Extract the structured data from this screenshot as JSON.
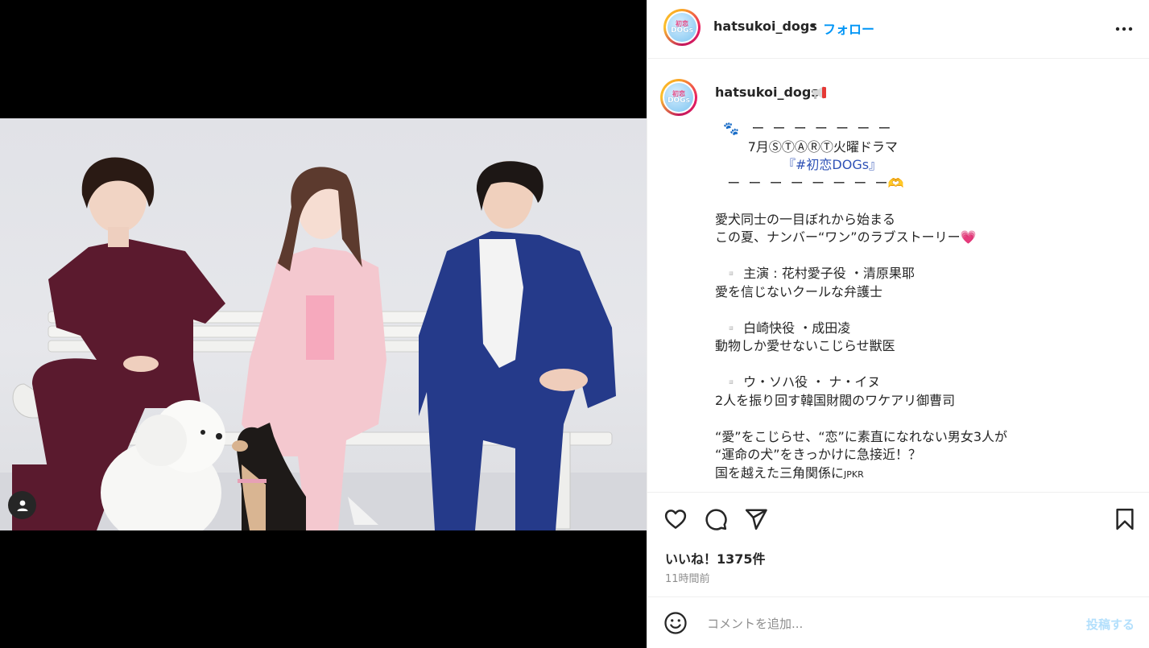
{
  "post": {
    "username": "hatsukoi_dogs",
    "separator": "•",
    "follow_label": "フォロー",
    "avatar_text_top": "初恋",
    "avatar_text_bottom": "DOGs"
  },
  "caption": {
    "username": "hatsukoi_dogs",
    "lines": [
      "  🐾   ー  ー  ー  ー  ー  ー  ー",
      "        7月ⓈⓉⒶⓇⓉ火曜ドラマ",
      "",
      "   ー  ー  ー  ー  ー  ー  ー  ー🫶",
      "",
      "愛犬同士の一目ぼれから始まる",
      "この夏、ナンバー“ワン”のラブストーリー💗",
      "",
      "  ▫️ 主演 : 花村愛子役 ・清原果耶",
      "愛を信じないクールな弁護士",
      "",
      "  ▫️ 白崎快役 ・成田凌",
      "動物しか愛せないこじらせ獣医",
      "",
      "  ▫️ ウ・ソハ役 ・ ナ・イヌ",
      "2人を振り回す韓国財閥のワケアリ御曹司",
      "",
      "“愛”をこじらせ、“恋”に素直になれない男女3人が",
      "“運命の犬”をきっかけに急接近！？",
      "国を越えた三角関係に"
    ],
    "hashtag": "『#初恋DOGs』",
    "last_suffix": "JPKR"
  },
  "actions": {
    "likes": "いいね！1375件",
    "time": "11時間前",
    "icons": [
      "heart-icon",
      "comment-icon",
      "share-icon",
      "bookmark-icon"
    ]
  },
  "comment": {
    "placeholder": "コメントを追加...",
    "post_label": "投稿する"
  },
  "colors": {
    "accent": "#0095f6",
    "hashtag": "#2f52b6",
    "text": "#262626",
    "muted": "#8e8e8e",
    "post_disabled": "#b2dffc"
  }
}
